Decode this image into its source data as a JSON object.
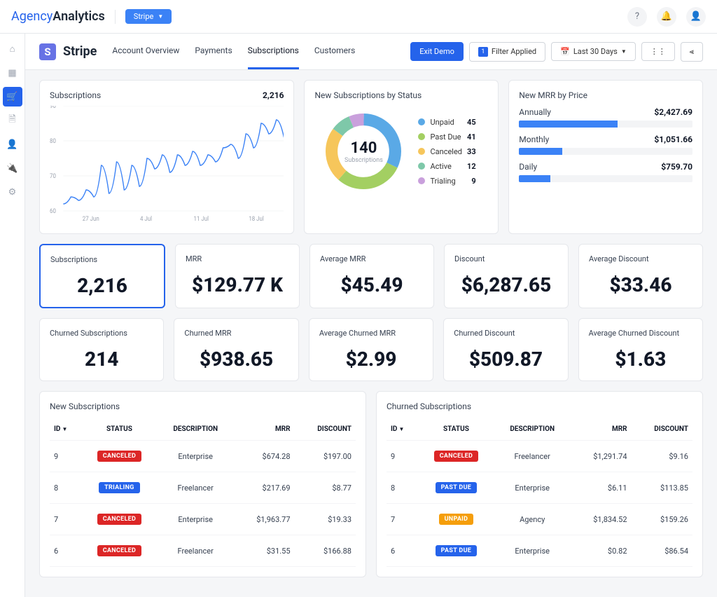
{
  "brand": {
    "p1": "Agency",
    "p2": "Analytics",
    "pill": "Stripe"
  },
  "subheader": {
    "icon": "S",
    "title": "Stripe"
  },
  "tabs": [
    "Account Overview",
    "Payments",
    "Subscriptions",
    "Customers"
  ],
  "activeTab": 2,
  "actions": {
    "exit": "Exit Demo",
    "filterCount": "1",
    "filterLabel": "Filter Applied",
    "dateRange": "Last 30 Days"
  },
  "chart_data": {
    "type": "line",
    "title": "Subscriptions",
    "total": "2,216",
    "ylim": [
      60,
      90
    ],
    "yticks": [
      60,
      70,
      80,
      90
    ],
    "xticks": [
      "27 Jun",
      "4 Jul",
      "11 Jul",
      "18 Jul"
    ],
    "values": [
      62,
      64,
      63,
      66,
      64,
      73,
      65,
      74,
      66,
      73,
      67,
      75,
      72,
      76,
      71,
      76,
      73,
      77,
      73,
      76,
      74,
      78,
      79,
      75,
      82,
      78,
      85,
      82,
      86,
      81
    ]
  },
  "donut": {
    "title": "New Subscriptions by Status",
    "center": "140",
    "centerSub": "Subscriptions",
    "items": [
      {
        "label": "Unpaid",
        "value": "45",
        "color": "#5aa9e6"
      },
      {
        "label": "Past Due",
        "value": "41",
        "color": "#a3cf62"
      },
      {
        "label": "Canceled",
        "value": "33",
        "color": "#f6c65b"
      },
      {
        "label": "Active",
        "value": "12",
        "color": "#7ec8a9"
      },
      {
        "label": "Trialing",
        "value": "9",
        "color": "#c9a0dc"
      }
    ]
  },
  "mrrPrice": {
    "title": "New MRR by Price",
    "rows": [
      {
        "label": "Annually",
        "value": "$2,427.69",
        "pct": 57
      },
      {
        "label": "Monthly",
        "value": "$1,051.66",
        "pct": 25
      },
      {
        "label": "Daily",
        "value": "$759.70",
        "pct": 18
      }
    ]
  },
  "metrics1": [
    {
      "label": "Subscriptions",
      "value": "2,216",
      "sel": true
    },
    {
      "label": "MRR",
      "value": "$129.77 K"
    },
    {
      "label": "Average MRR",
      "value": "$45.49"
    },
    {
      "label": "Discount",
      "value": "$6,287.65"
    },
    {
      "label": "Average Discount",
      "value": "$33.46"
    }
  ],
  "metrics2": [
    {
      "label": "Churned Subscriptions",
      "value": "214"
    },
    {
      "label": "Churned MRR",
      "value": "$938.65"
    },
    {
      "label": "Average Churned MRR",
      "value": "$2.99"
    },
    {
      "label": "Churned Discount",
      "value": "$509.87"
    },
    {
      "label": "Average Churned Discount",
      "value": "$1.63"
    }
  ],
  "tableHeaders": [
    "ID",
    "STATUS",
    "DESCRIPTION",
    "MRR",
    "DISCOUNT"
  ],
  "newSubs": {
    "title": "New Subscriptions",
    "rows": [
      {
        "id": "9",
        "status": "CANCELED",
        "cls": "b-canceled",
        "desc": "Enterprise",
        "mrr": "$674.28",
        "disc": "$197.00"
      },
      {
        "id": "8",
        "status": "TRIALING",
        "cls": "b-trialing",
        "desc": "Freelancer",
        "mrr": "$217.69",
        "disc": "$8.77"
      },
      {
        "id": "7",
        "status": "CANCELED",
        "cls": "b-canceled",
        "desc": "Enterprise",
        "mrr": "$1,963.77",
        "disc": "$19.33"
      },
      {
        "id": "6",
        "status": "CANCELED",
        "cls": "b-canceled",
        "desc": "Freelancer",
        "mrr": "$31.55",
        "disc": "$166.88"
      }
    ]
  },
  "churnSubs": {
    "title": "Churned Subscriptions",
    "rows": [
      {
        "id": "9",
        "status": "CANCELED",
        "cls": "b-canceled",
        "desc": "Freelancer",
        "mrr": "$1,291.74",
        "disc": "$9.16"
      },
      {
        "id": "8",
        "status": "PAST DUE",
        "cls": "b-pastdue",
        "desc": "Enterprise",
        "mrr": "$6.11",
        "disc": "$113.85"
      },
      {
        "id": "7",
        "status": "UNPAID",
        "cls": "b-unpaid",
        "desc": "Agency",
        "mrr": "$1,834.52",
        "disc": "$159.26"
      },
      {
        "id": "6",
        "status": "PAST DUE",
        "cls": "b-pastdue",
        "desc": "Enterprise",
        "mrr": "$0.82",
        "disc": "$86.54"
      }
    ]
  }
}
